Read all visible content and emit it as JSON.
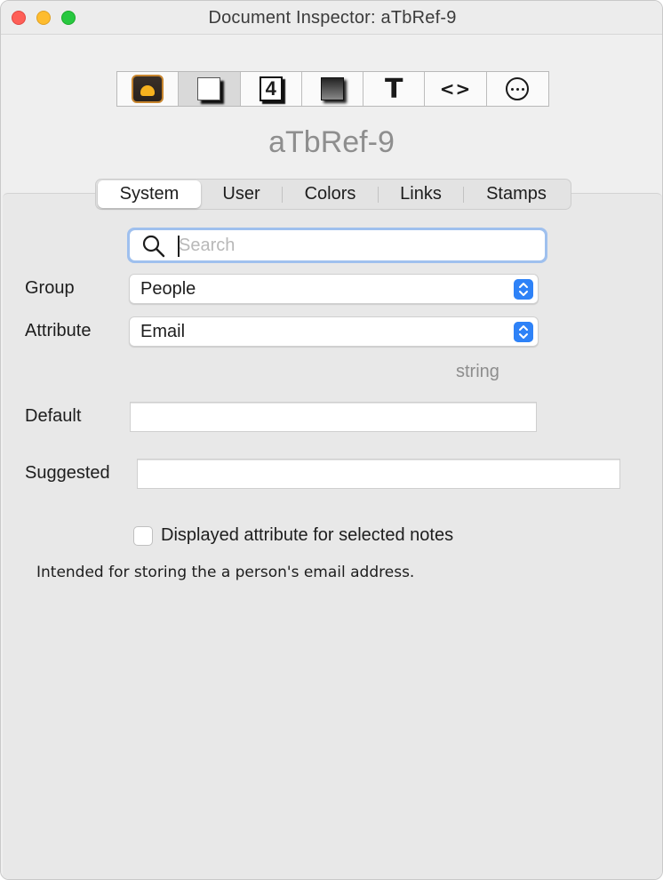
{
  "window": {
    "title": "Document Inspector: aTbRef-9"
  },
  "toolbar": {
    "buttons": [
      {
        "name": "document",
        "icon": "app-icon",
        "selected": false
      },
      {
        "name": "note",
        "icon": "doc-white-icon",
        "selected": true
      },
      {
        "name": "number",
        "icon": "number-four-icon",
        "label": "4",
        "selected": false
      },
      {
        "name": "shadow",
        "icon": "shadow-box-icon",
        "selected": false
      },
      {
        "name": "text",
        "icon": "text-icon",
        "label": "T",
        "selected": false
      },
      {
        "name": "code",
        "icon": "code-icon",
        "label": "<>",
        "selected": false
      },
      {
        "name": "more",
        "icon": "more-icon",
        "selected": false
      }
    ]
  },
  "document_name": "aTbRef-9",
  "tabs": [
    {
      "label": "System",
      "selected": true
    },
    {
      "label": "User",
      "selected": false
    },
    {
      "label": "Colors",
      "selected": false
    },
    {
      "label": "Links",
      "selected": false
    },
    {
      "label": "Stamps",
      "selected": false
    }
  ],
  "search": {
    "placeholder": "Search",
    "value": ""
  },
  "form": {
    "group_label": "Group",
    "group_value": "People",
    "attribute_label": "Attribute",
    "attribute_value": "Email",
    "type_hint": "string",
    "default_label": "Default",
    "default_value": "",
    "suggested_label": "Suggested",
    "suggested_value": "",
    "displayed_checkbox_label": "Displayed attribute for selected notes",
    "displayed_checked": false,
    "description": "Intended for storing the a person's email address."
  },
  "colors": {
    "accent": "#2e82f7",
    "focus_ring": "#9fc0ee"
  }
}
